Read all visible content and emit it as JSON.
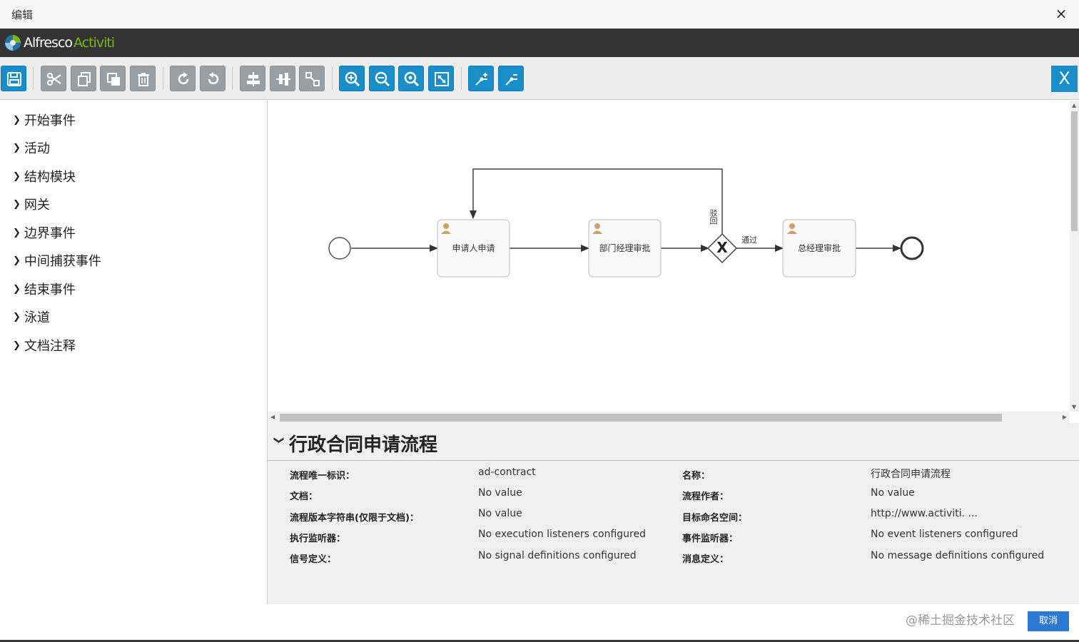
{
  "dialog": {
    "title": "编辑",
    "close_glyph": "×"
  },
  "brand": {
    "name_part1": "Alfresco",
    "name_part2": "Activiti",
    "logo_icon": "activiti-logo-icon",
    "accent": "#7ab51d"
  },
  "toolbar": {
    "buttons": [
      "save-icon",
      "cut-icon",
      "copy-icon",
      "paste-icon",
      "delete-icon",
      "redo-icon",
      "undo-icon",
      "align-horizontal-icon",
      "align-vertical-icon",
      "same-size-icon",
      "zoom-in-icon",
      "zoom-out-icon",
      "zoom-actual-icon",
      "zoom-fit-icon",
      "add-bendpoint-icon",
      "remove-bendpoint-icon"
    ],
    "close_label": "X",
    "accent": "#1a8ec9"
  },
  "palette": {
    "items": [
      "开始事件",
      "活动",
      "结构模块",
      "网关",
      "边界事件",
      "中间捕获事件",
      "结束事件",
      "泳道",
      "文档注释"
    ]
  },
  "diagram": {
    "tasks": [
      "申请人申请",
      "部门经理审批",
      "总经理审批"
    ],
    "flow_labels": {
      "reject": "驳回",
      "approve": "通过"
    },
    "gateway_glyph": "X"
  },
  "properties": {
    "title": "行政合同申请流程",
    "rows": [
      {
        "label": "流程唯一标识：",
        "value": "ad-contract",
        "label2": "名称：",
        "value2": "行政合同申请流程"
      },
      {
        "label": "文档：",
        "value": "No value",
        "label2": "流程作者：",
        "value2": "No value"
      },
      {
        "label": "流程版本字符串(仅限于文档)：",
        "value": "No value",
        "label2": "目标命名空间：",
        "value2": "http://www.activiti. ..."
      },
      {
        "label": "执行监听器：",
        "value": "No execution listeners configured",
        "label2": "事件监听器：",
        "value2": "No event listeners configured"
      },
      {
        "label": "信号定义：",
        "value": "No signal definitions configured",
        "label2": "消息定义：",
        "value2": "No message definitions configured"
      }
    ]
  },
  "footer": {
    "watermark": "@稀土掘金技术社区",
    "cancel_label": "取消"
  }
}
